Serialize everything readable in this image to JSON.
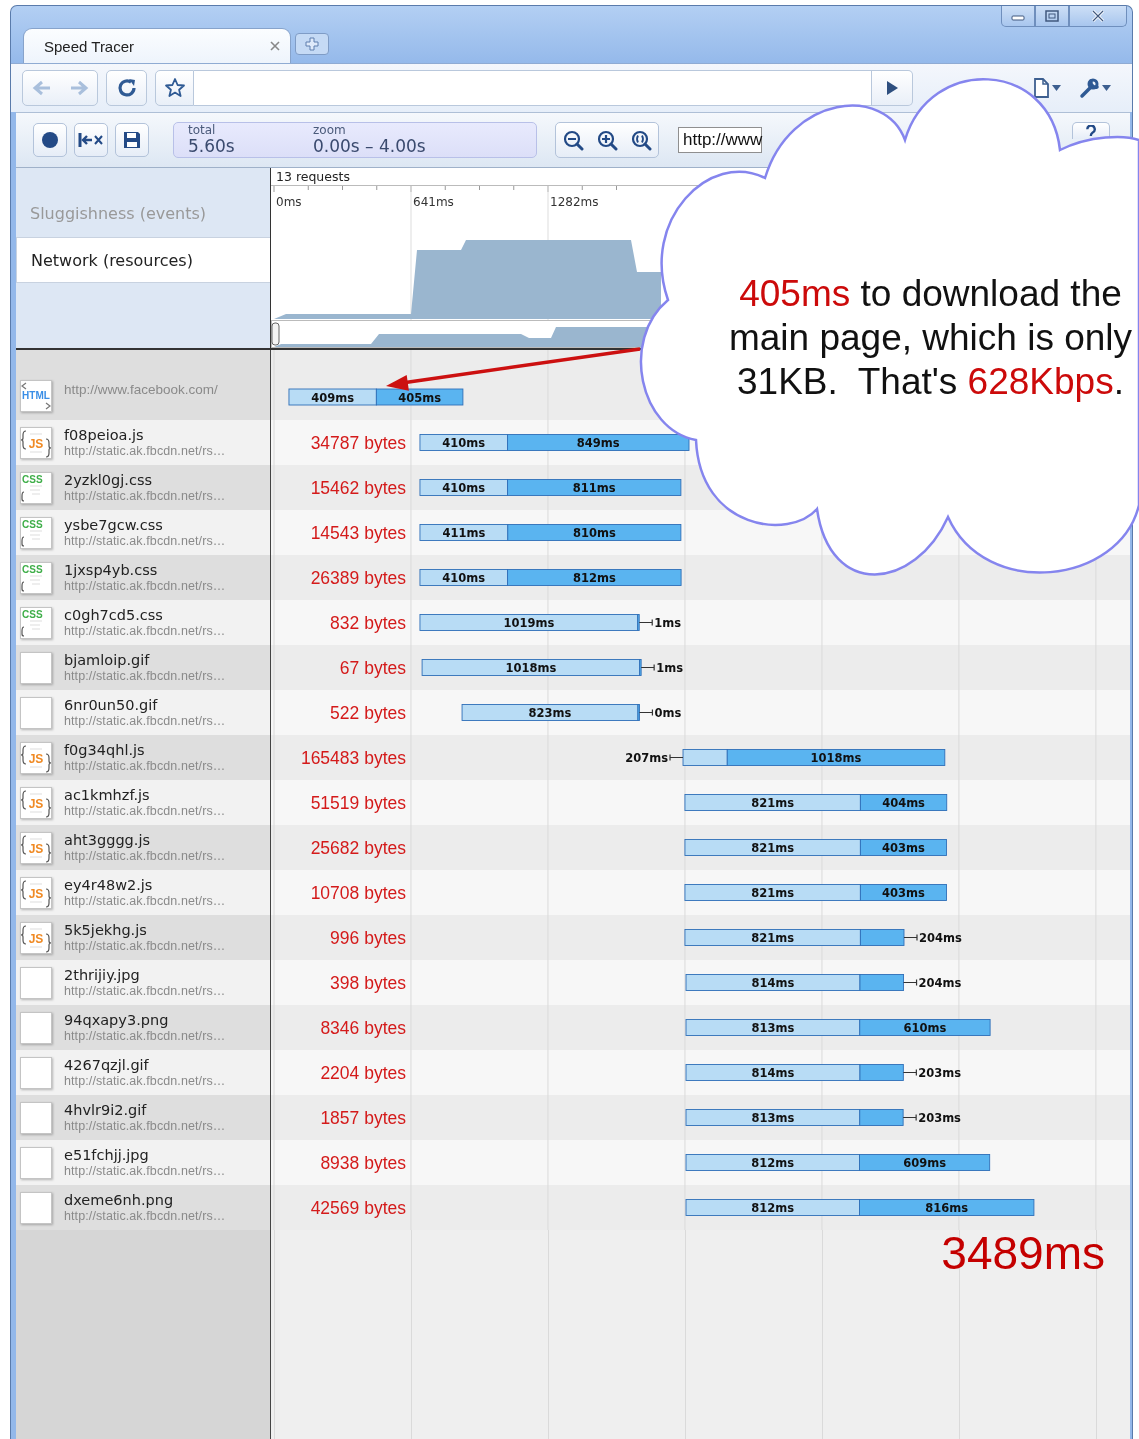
{
  "browser": {
    "tabs": [
      {
        "title": "Speed Tracer",
        "selected": true
      }
    ],
    "navigation": {
      "back_disabled": true,
      "forward_disabled": true
    }
  },
  "tracer_toolbar": {
    "total_label": "total",
    "total_value": "5.60s",
    "zoom_label": "zoom",
    "zoom_value": "0.00s – 4.00s",
    "url_value": "http://www"
  },
  "overview": {
    "views": [
      {
        "label": "Sluggishness (events)",
        "selected": false
      },
      {
        "label": "Network (resources)",
        "selected": true
      }
    ],
    "request_count": "13 requests",
    "ticks": [
      "0ms",
      "641ms",
      "1282ms"
    ]
  },
  "requests": [
    {
      "kind": "html",
      "icon_text": "HTML",
      "url": "http://www.facebook.com/",
      "wait": "409ms",
      "download": "405ms"
    },
    {
      "kind": "js",
      "icon_text": "JS",
      "name": "f08peioa.js",
      "url": "http://static.ak.fbcdn.net/rs…",
      "size": "34787 bytes",
      "wait": "410ms",
      "download": "849ms"
    },
    {
      "kind": "css",
      "icon_text": "CSS",
      "name": "2yzkl0gj.css",
      "url": "http://static.ak.fbcdn.net/rs…",
      "size": "15462 bytes",
      "wait": "410ms",
      "download": "811ms"
    },
    {
      "kind": "css",
      "icon_text": "CSS",
      "name": "ysbe7gcw.css",
      "url": "http://static.ak.fbcdn.net/rs…",
      "size": "14543 bytes",
      "wait": "411ms",
      "download": "810ms"
    },
    {
      "kind": "css",
      "icon_text": "CSS",
      "name": "1jxsp4yb.css",
      "url": "http://static.ak.fbcdn.net/rs…",
      "size": "26389 bytes",
      "wait": "410ms",
      "download": "812ms"
    },
    {
      "kind": "css",
      "icon_text": "CSS",
      "name": "c0gh7cd5.css",
      "url": "http://static.ak.fbcdn.net/rs…",
      "size": "832 bytes",
      "wait": "1019ms",
      "download": "1ms"
    },
    {
      "kind": "image",
      "name": "bjamloip.gif",
      "url": "http://static.ak.fbcdn.net/rs…",
      "size": "67 bytes",
      "wait": "1018ms",
      "download": "1ms"
    },
    {
      "kind": "image",
      "name": "6nr0un50.gif",
      "url": "http://static.ak.fbcdn.net/rs…",
      "size": "522 bytes",
      "wait": "823ms",
      "download": "0ms"
    },
    {
      "kind": "js",
      "icon_text": "JS",
      "name": "f0g34qhl.js",
      "url": "http://static.ak.fbcdn.net/rs…",
      "size": "165483 bytes",
      "wait": "207ms",
      "download": "1018ms"
    },
    {
      "kind": "js",
      "icon_text": "JS",
      "name": "ac1kmhzf.js",
      "url": "http://static.ak.fbcdn.net/rs…",
      "size": "51519 bytes",
      "wait": "821ms",
      "download": "404ms"
    },
    {
      "kind": "js",
      "icon_text": "JS",
      "name": "aht3gggg.js",
      "url": "http://static.ak.fbcdn.net/rs…",
      "size": "25682 bytes",
      "wait": "821ms",
      "download": "403ms"
    },
    {
      "kind": "js",
      "icon_text": "JS",
      "name": "ey4r48w2.js",
      "url": "http://static.ak.fbcdn.net/rs…",
      "size": "10708 bytes",
      "wait": "821ms",
      "download": "403ms"
    },
    {
      "kind": "js",
      "icon_text": "JS",
      "name": "5k5jekhg.js",
      "url": "http://static.ak.fbcdn.net/rs…",
      "size": "996 bytes",
      "wait": "821ms",
      "download": "204ms"
    },
    {
      "kind": "image",
      "name": "2thrijiy.jpg",
      "url": "http://static.ak.fbcdn.net/rs…",
      "size": "398 bytes",
      "wait": "814ms",
      "download": "204ms"
    },
    {
      "kind": "image",
      "name": "94qxapy3.png",
      "url": "http://static.ak.fbcdn.net/rs…",
      "size": "8346 bytes",
      "wait": "813ms",
      "download": "610ms"
    },
    {
      "kind": "image",
      "name": "4267qzjl.gif",
      "url": "http://static.ak.fbcdn.net/rs…",
      "size": "2204 bytes",
      "wait": "814ms",
      "download": "203ms"
    },
    {
      "kind": "image",
      "name": "4hvlr9i2.gif",
      "url": "http://static.ak.fbcdn.net/rs…",
      "size": "1857 bytes",
      "wait": "813ms",
      "download": "203ms"
    },
    {
      "kind": "image",
      "name": "e51fchjj.jpg",
      "url": "http://static.ak.fbcdn.net/rs…",
      "size": "8938 bytes",
      "wait": "812ms",
      "download": "609ms"
    },
    {
      "kind": "image",
      "name": "dxeme6nh.png",
      "url": "http://static.ak.fbcdn.net/rs…",
      "size": "42569 bytes",
      "wait": "812ms",
      "download": "816ms"
    }
  ],
  "callout": {
    "segments": [
      {
        "text": "405ms",
        "highlight": true
      },
      {
        "text": " to download the main page, which is only 31KB.  That's ",
        "highlight": false
      },
      {
        "text": "628Kbps",
        "highlight": true
      },
      {
        "text": ".",
        "highlight": false
      }
    ]
  },
  "total_time": "3489ms"
}
